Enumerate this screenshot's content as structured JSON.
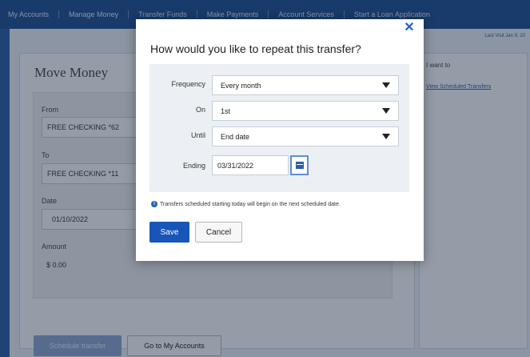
{
  "nav": {
    "items": [
      "My Accounts",
      "Manage Money",
      "Transfer Funds",
      "Make Payments",
      "Account Services",
      "Start a Loan Application"
    ]
  },
  "header": {
    "last_visit": "Last Visit Jan 9, 20"
  },
  "move_money": {
    "title": "Move Money",
    "from_label": "From",
    "from_value": "FREE CHECKING *62",
    "to_label": "To",
    "to_value": "FREE CHECKING *11",
    "date_label": "Date",
    "date_value": "01/10/2022",
    "amount_label": "Amount",
    "amount_value": "$ 0.00",
    "schedule_button": "Schedule transfer",
    "goto_button": "Go to My Accounts"
  },
  "side": {
    "title": "I want to",
    "link": "View Scheduled Transfers"
  },
  "modal": {
    "title": "How would you like to repeat this transfer?",
    "close": "✕",
    "frequency_label": "Frequency",
    "frequency_value": "Every month",
    "on_label": "On",
    "on_value": "1st",
    "until_label": "Until",
    "until_value": "End date",
    "ending_label": "Ending",
    "ending_value": "03/31/2022",
    "info_icon": "i",
    "info_text": "Transfers scheduled starting today will begin on the next scheduled date.",
    "save": "Save",
    "cancel": "Cancel"
  },
  "colors": {
    "brand_blue": "#1d4f93",
    "primary_button": "#1755b8",
    "accent_link": "#1e62c4"
  },
  "icons": {
    "close": "close-icon",
    "calendar": "calendar-icon",
    "info": "info-icon",
    "dropdown": "chevron-down-icon"
  }
}
